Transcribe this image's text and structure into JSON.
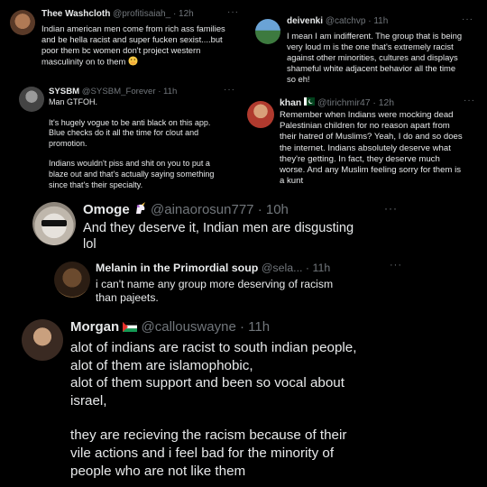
{
  "tweets": [
    {
      "name": "Thee Washcloth",
      "handle": "@profitisaiah_",
      "time": "· 12h",
      "more": "···",
      "lines": [
        "Indian american men come from rich ass families",
        "and be hella racist and super fucken sexist....but",
        "poor them bc women don't project western",
        "masculinity on to them"
      ],
      "emoji": "face-with-hand-over-mouth-emoji"
    },
    {
      "name": "deivenki",
      "handle": "@catchvp",
      "time": "· 11h",
      "more": "···",
      "lines": [
        "I mean I am indifferent. The group that is being",
        "very loud m is the one that's extremely racist",
        "against other minorities, cultures and displays",
        "shameful white adjacent behavior all the time",
        "so eh!"
      ]
    },
    {
      "name": "SYSBM",
      "handle": "@SYSBM_Forever",
      "time": "· 11h",
      "more": "···",
      "paragraphs": [
        [
          "Man GTFOH."
        ],
        [
          "It's hugely vogue to be anti black on this app.",
          "Blue checks do it all the time for clout and",
          "promotion."
        ],
        [
          "Indians wouldn't piss and shit on you to put a",
          "blaze out and that's actually saying something",
          "since that's their specialty."
        ]
      ]
    },
    {
      "name": "khan",
      "handle": "@tirichmir47",
      "time": "· 12h",
      "more": "···",
      "flag": "pakistan-flag",
      "lines": [
        "Remember when Indians were mocking dead",
        "Palestinian children for no reason apart from",
        "their hatred of Muslims? Yeah, I do and so does",
        "the internet. Indians absolutely deserve what",
        "they're getting. In fact, they deserve much",
        "worse. And any Muslim feeling sorry for them is",
        "a kunt"
      ]
    },
    {
      "name": "Omoge",
      "handle": "@ainaorosun777",
      "time": "· 10h",
      "more": "···",
      "emoji": "unicorn-emoji",
      "lines": [
        "And they deserve it, Indian men are disgusting",
        "lol"
      ]
    },
    {
      "name": "Melanin in the Primordial soup",
      "handle": "@sela...",
      "time": "· 11h",
      "more": "···",
      "lines": [
        "i can't name any group more deserving of racism",
        "than pajeets."
      ]
    },
    {
      "name": "Morgan",
      "handle": "@callouswayne",
      "time": "· 11h",
      "more": "···",
      "flag": "palestine-flag",
      "paragraphs": [
        [
          "alot of indians are racist to south indian people,",
          "alot of them are islamophobic,",
          "alot of them support and been so vocal about",
          "israel,"
        ],
        [
          "they are recieving the racism because of their",
          "vile actions and i feel bad for the minority of",
          "people who are not like them"
        ]
      ]
    }
  ]
}
